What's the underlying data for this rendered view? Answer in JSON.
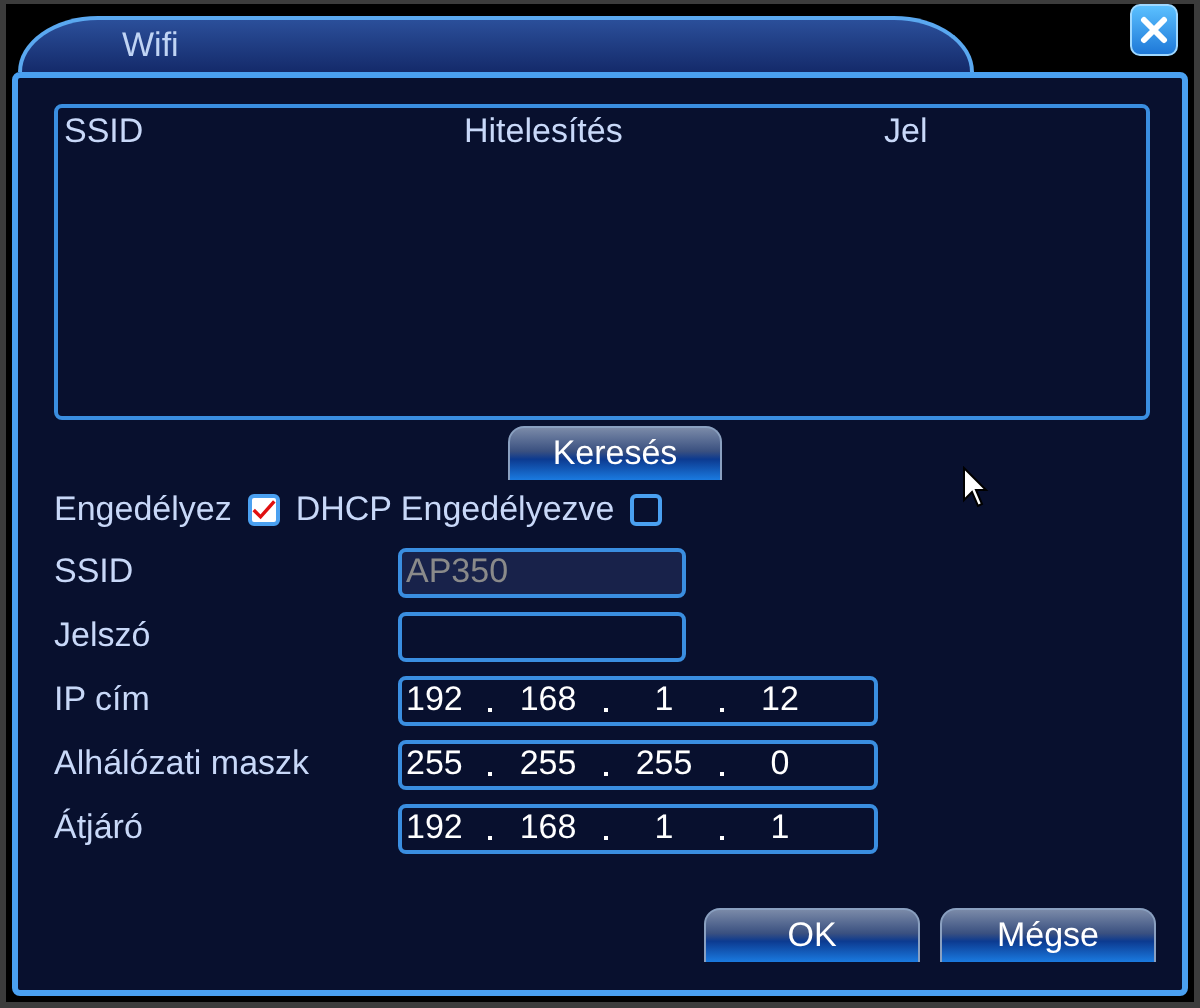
{
  "window": {
    "title": "Wifi"
  },
  "table": {
    "columns": [
      "SSID",
      "Hitelesítés",
      "Jel"
    ]
  },
  "search_button": "Keresés",
  "options": [
    {
      "label": "Engedélyez",
      "checked": true
    },
    {
      "label": "DHCP Engedélyezve",
      "checked": false
    }
  ],
  "fields": [
    {
      "label": "SSID",
      "kind": "text",
      "value": "AP350",
      "disabled": true
    },
    {
      "label": "Jelszó",
      "kind": "password",
      "disabled": false
    },
    {
      "label": "IP cím",
      "kind": "ip",
      "octets": [
        "192",
        "168",
        "1",
        "12"
      ],
      "disabled": false
    },
    {
      "label": "Alhálózati maszk",
      "kind": "ip",
      "octets": [
        "255",
        "255",
        "255",
        "0"
      ],
      "disabled": false
    },
    {
      "label": "Átjáró",
      "kind": "ip",
      "octets": [
        "192",
        "168",
        "1",
        "1"
      ],
      "disabled": false
    }
  ],
  "buttons": [
    "OK",
    "Mégse"
  ]
}
